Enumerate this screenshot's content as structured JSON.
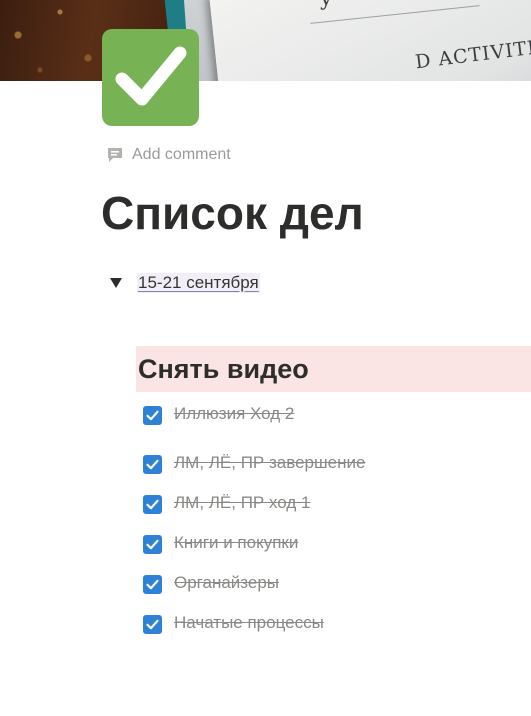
{
  "cover": {
    "paper_text": "D ACTIVITI",
    "paper_glyph": "y"
  },
  "page_icon": {
    "name": "check-mark-button-icon",
    "color": "#77b255"
  },
  "comment": {
    "label": "Add comment",
    "icon": "comment-icon"
  },
  "title": "Список дел",
  "toggle": {
    "label": "15-21 сентября",
    "expanded": true,
    "icon": "triangle-down-icon"
  },
  "section": {
    "heading": "Снять видео",
    "background": "#fbe4e4"
  },
  "todos": [
    {
      "text": "Иллюзия Ход 2",
      "checked": true
    },
    {
      "text": "ЛМ, ЛЁ, ПР завершение",
      "checked": true
    },
    {
      "text": "ЛМ, ЛЁ, ПР ход 1",
      "checked": true
    },
    {
      "text": "Книги и покупки",
      "checked": true
    },
    {
      "text": "Органайзеры",
      "checked": true
    },
    {
      "text": "Начатые процессы",
      "checked": true
    }
  ],
  "colors": {
    "checkbox": "#2e82d6",
    "done_text": "#8a8986"
  }
}
